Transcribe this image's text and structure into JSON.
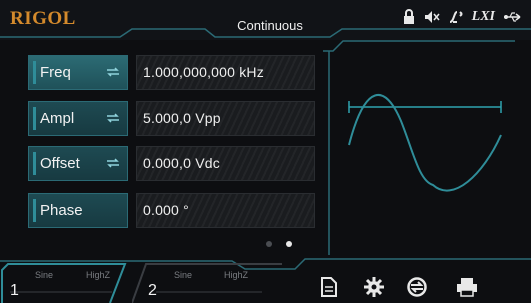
{
  "header": {
    "brand": "RIGOL",
    "mode": "Continuous",
    "status_icons": [
      "lock-icon",
      "mute-icon",
      "sweep-icon",
      "lxi-icon",
      "usb-icon"
    ],
    "lxi_text": "LXI"
  },
  "params": [
    {
      "key": "Freq",
      "value": "1.000,000,000 kHz",
      "active": true
    },
    {
      "key": "Ampl",
      "value": "5.000,0 Vpp",
      "active": false
    },
    {
      "key": "Offset",
      "value": "0.000,0 Vdc",
      "active": false
    },
    {
      "key": "Phase",
      "value": "0.000 °",
      "active": false
    }
  ],
  "channels": [
    {
      "number": "1",
      "wave": "Sine",
      "load": "HighZ",
      "active": true
    },
    {
      "number": "2",
      "wave": "Sine",
      "load": "HighZ",
      "active": false
    }
  ],
  "toolbar": [
    "file-icon",
    "gear-icon",
    "cycle-icon",
    "printer-icon"
  ],
  "pages": {
    "count": 2,
    "current": 2
  },
  "colors": {
    "accent": "#2f8d99",
    "brand": "#d48a2c",
    "background": "#0d0e11"
  }
}
